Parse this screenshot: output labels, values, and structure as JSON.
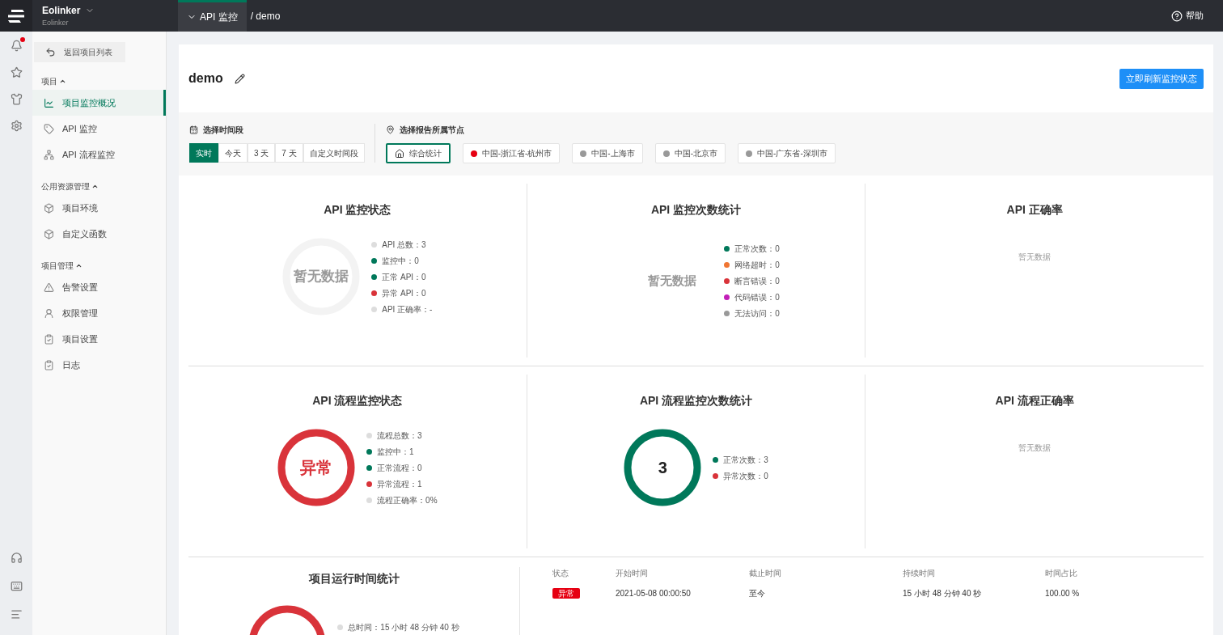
{
  "topbar": {
    "brand": "Eolinker",
    "brand_sub": "Eolinker",
    "breadcrumb": [
      {
        "label": "API 监控",
        "selected": true
      }
    ],
    "path": "/ demo",
    "help": "帮助"
  },
  "rail": {
    "has_unread": true
  },
  "sidebar": {
    "back": "返回项目列表",
    "sections": [
      {
        "title": "项目",
        "expanded": true,
        "items": [
          {
            "label": "项目监控概况",
            "selected": true
          },
          {
            "label": "API 监控",
            "selected": false
          },
          {
            "label": "API 流程监控",
            "selected": false
          }
        ]
      },
      {
        "title": "公用资源管理",
        "expanded": true,
        "items": [
          {
            "label": "项目环境",
            "selected": false
          },
          {
            "label": "自定义函数",
            "selected": false
          }
        ]
      },
      {
        "title": "项目管理",
        "expanded": true,
        "items": [
          {
            "label": "告警设置",
            "selected": false
          },
          {
            "label": "权限管理",
            "selected": false
          },
          {
            "label": "项目设置",
            "selected": false
          },
          {
            "label": "日志",
            "selected": false
          }
        ]
      }
    ]
  },
  "project": {
    "name": "demo",
    "refresh_button": "立即刷新监控状态"
  },
  "filters": {
    "time_label": "选择时间段",
    "time_options": [
      {
        "label": "实时",
        "selected": true
      },
      {
        "label": "今天",
        "selected": false
      },
      {
        "label": "3 天",
        "selected": false
      },
      {
        "label": "7 天",
        "selected": false
      },
      {
        "label": "自定义时间段",
        "selected": false
      }
    ],
    "node_label": "选择报告所属节点",
    "nodes": [
      {
        "kind": "summary",
        "label": "综合统计",
        "selected": true
      },
      {
        "kind": "node",
        "label": "中国-浙江省-杭州市",
        "color": "#e60012",
        "selected": false
      },
      {
        "kind": "node",
        "label": "中国-上海市",
        "color": "#999999",
        "selected": false
      },
      {
        "kind": "node",
        "label": "中国-北京市",
        "color": "#999999",
        "selected": false
      },
      {
        "kind": "node",
        "label": "中国-广东省-深圳市",
        "color": "#999999",
        "selected": false
      }
    ]
  },
  "panel_rows": [
    [
      {
        "title": "API 监控状态",
        "kind": "empty-ring",
        "center": "暂无数据",
        "legend": [
          {
            "label": "API 总数：3",
            "color": "#dddddd"
          },
          {
            "label": "监控中：0",
            "color": "#00785a"
          },
          {
            "label": "正常 API：0",
            "color": "#00785a"
          },
          {
            "label": "异常 API：0",
            "color": "#d9333a"
          },
          {
            "label": "API 正确率：-",
            "color": "#dddddd"
          }
        ]
      },
      {
        "title": "API 监控次数统计",
        "kind": "text",
        "center": "暂无数据",
        "legend": [
          {
            "label": "正常次数：0",
            "color": "#00785a"
          },
          {
            "label": "网络超时：0",
            "color": "#f07633"
          },
          {
            "label": "断言错误：0",
            "color": "#d9333a"
          },
          {
            "label": "代码错误：0",
            "color": "#c21fb8"
          },
          {
            "label": "无法访问：0",
            "color": "#999999"
          }
        ]
      },
      {
        "title": "API 正确率",
        "kind": "empty",
        "center": "暂无数据"
      }
    ],
    [
      {
        "title": "API 流程监控状态",
        "kind": "alert-ring",
        "center": "异常",
        "legend": [
          {
            "label": "流程总数：3",
            "color": "#dddddd"
          },
          {
            "label": "监控中：1",
            "color": "#00785a"
          },
          {
            "label": "正常流程：0",
            "color": "#00785a"
          },
          {
            "label": "异常流程：1",
            "color": "#d9333a"
          },
          {
            "label": "流程正确率：0%",
            "color": "#dddddd"
          }
        ]
      },
      {
        "title": "API 流程监控次数统计",
        "kind": "count-ring",
        "center": "3",
        "legend": [
          {
            "label": "正常次数：3",
            "color": "#00785a"
          },
          {
            "label": "异常次数：0",
            "color": "#d9333a"
          }
        ]
      },
      {
        "title": "API 流程正确率",
        "kind": "empty",
        "center": "暂无数据"
      }
    ]
  ],
  "runtime": {
    "title": "项目运行时间统计",
    "kind": "alert-ring",
    "legend": [
      {
        "label": "总时间：15 小时 48 分钟 40 秒",
        "color": "#dddddd"
      }
    ],
    "table": {
      "columns": [
        "状态",
        "开始时间",
        "截止时间",
        "持续时间",
        "时间占比"
      ],
      "rows": [
        {
          "status": "异常",
          "start": "2021-05-08 00:00:50",
          "end": "至今",
          "duration": "15 小时 48 分钟 40 秒",
          "ratio": "100.00 %"
        }
      ]
    }
  }
}
